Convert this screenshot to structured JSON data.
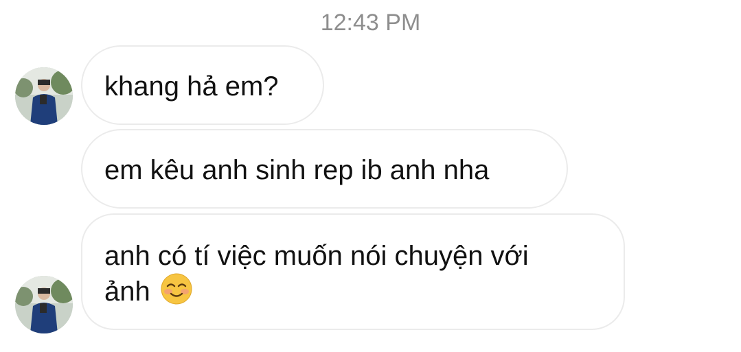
{
  "thread": {
    "timestamp": "12:43 PM",
    "messages": [
      {
        "sender": "contact",
        "text": "khang hả em?"
      },
      {
        "sender": "contact",
        "text": "em kêu anh sinh rep ib anh nha"
      },
      {
        "sender": "contact",
        "text_line1": "anh có tí việc muốn nói chuyện với",
        "text_line2": "ảnh",
        "emoji": "smiling-face-icon"
      }
    ]
  },
  "colors": {
    "bubble_border": "#ebebeb",
    "timestamp_text": "#8e8e8e",
    "message_text": "#111111"
  }
}
